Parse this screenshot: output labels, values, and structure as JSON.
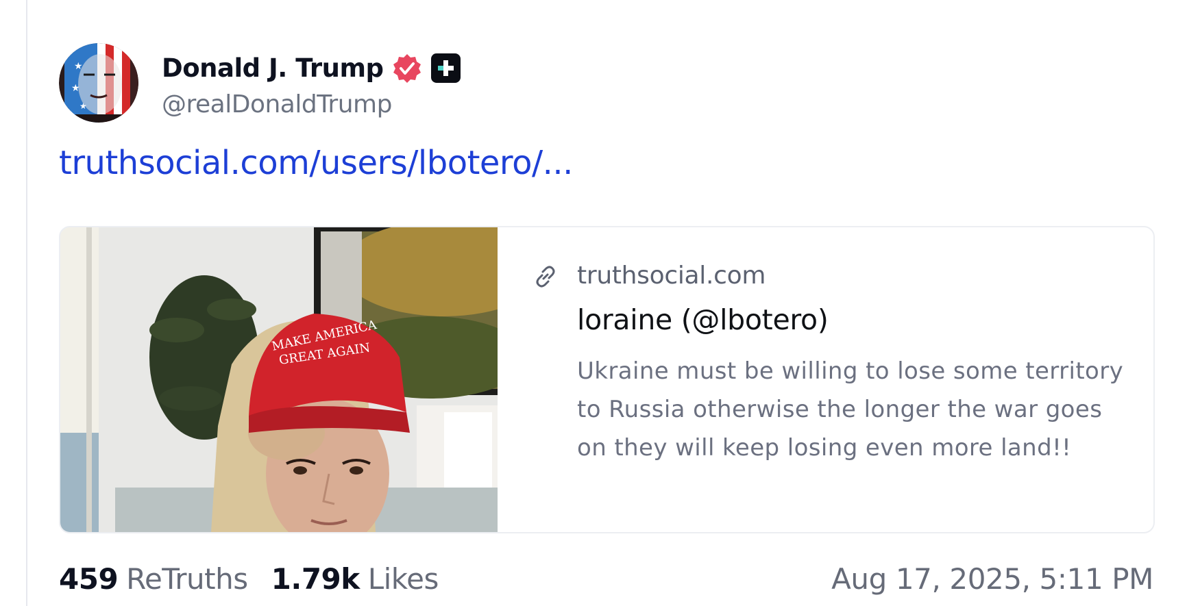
{
  "post": {
    "author": {
      "name": "Donald J. Trump",
      "handle": "@realDonaldTrump",
      "avatar_icon": "avatar-flag-portrait",
      "verified_icon": "verified-badge-icon",
      "plus_icon": "plus-badge-icon"
    },
    "link_text": "truthsocial.com/users/lbotero/...",
    "card": {
      "image_description_icon": "card-photo",
      "domain": "truthsocial.com",
      "title": "loraine (@lbotero)",
      "description": "Ukraine must be willing to lose some territory to Russia otherwise the longer the war goes on they will keep losing even more land!!",
      "hat_text_line1": "MAKE AMERICA",
      "hat_text_line2": "GREAT AGAIN",
      "link_icon": "link-icon"
    },
    "stats": {
      "retruths_value": "459",
      "retruths_label": "ReTruths",
      "likes_value": "1.79k",
      "likes_label": "Likes"
    },
    "timestamp": "Aug 17, 2025, 5:11 PM"
  },
  "colors": {
    "link": "#1d3fd6",
    "verified": "#e8465f",
    "text_primary": "#0e1220",
    "text_secondary": "#666b78",
    "border": "#eceef2"
  }
}
